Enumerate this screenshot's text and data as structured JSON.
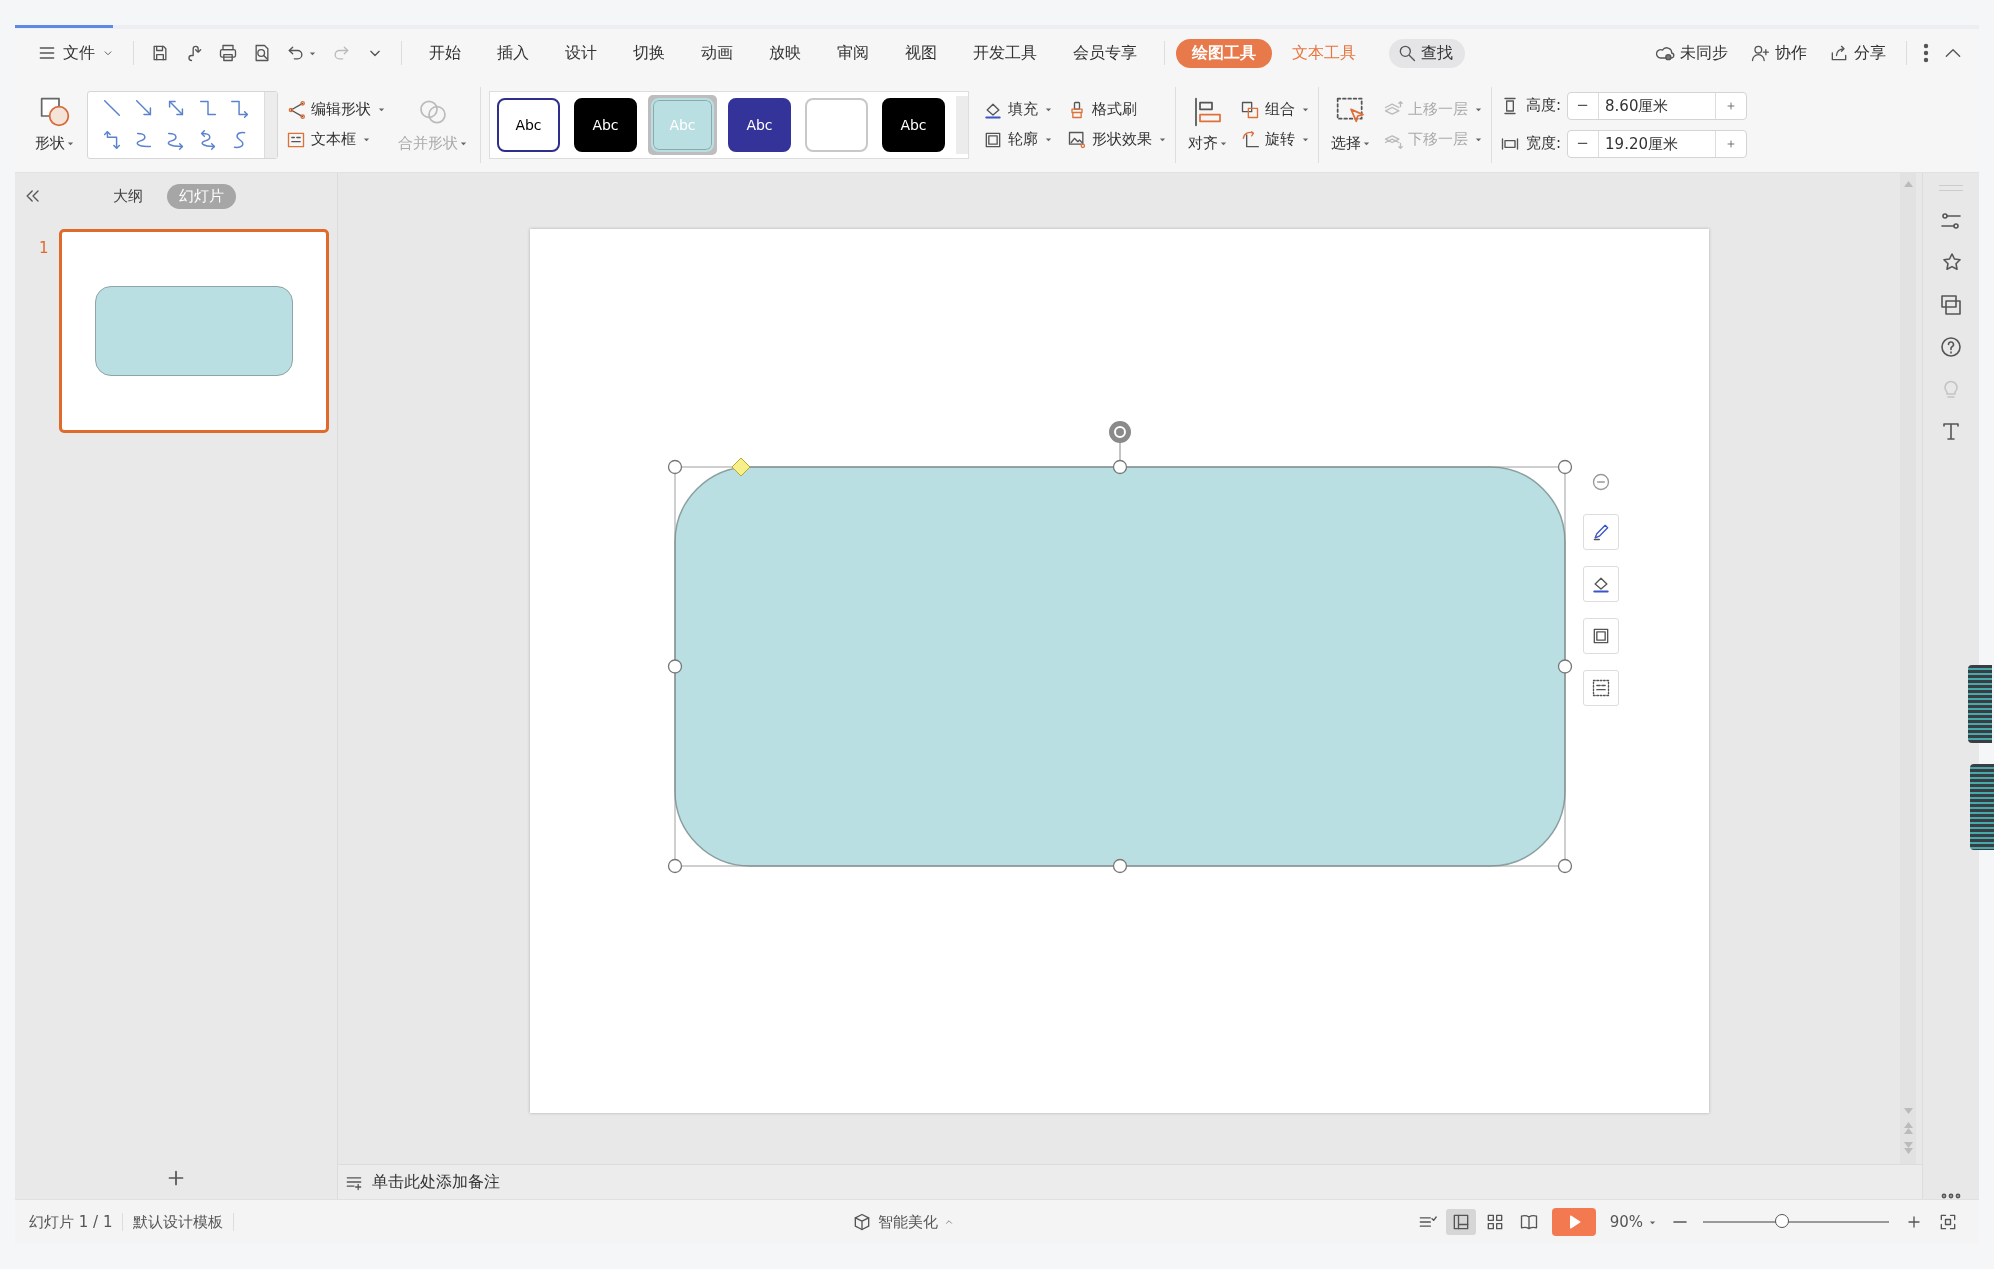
{
  "menu": {
    "file_label": "文件",
    "tabs": [
      {
        "label": "开始",
        "selected": false,
        "kind": "normal"
      },
      {
        "label": "插入",
        "selected": false,
        "kind": "normal"
      },
      {
        "label": "设计",
        "selected": false,
        "kind": "normal"
      },
      {
        "label": "切换",
        "selected": false,
        "kind": "normal"
      },
      {
        "label": "动画",
        "selected": false,
        "kind": "normal"
      },
      {
        "label": "放映",
        "selected": false,
        "kind": "normal"
      },
      {
        "label": "审阅",
        "selected": false,
        "kind": "normal"
      },
      {
        "label": "视图",
        "selected": false,
        "kind": "normal"
      },
      {
        "label": "开发工具",
        "selected": false,
        "kind": "normal"
      },
      {
        "label": "会员专享",
        "selected": false,
        "kind": "normal"
      },
      {
        "label": "绘图工具",
        "selected": true,
        "kind": "context"
      },
      {
        "label": "文本工具",
        "selected": false,
        "kind": "context"
      }
    ],
    "search": "查找",
    "actions": [
      "未同步",
      "协作",
      "分享"
    ]
  },
  "ribbon": {
    "shape_button": {
      "label": "形状",
      "dropdown": true
    },
    "edit_buttons": [
      {
        "label": "编辑形状",
        "dropdown": true,
        "disabled": false
      },
      {
        "label": "文本框",
        "dropdown": true,
        "disabled": false
      }
    ],
    "merge_button": {
      "label": "合并形状",
      "dropdown": true,
      "disabled": true
    },
    "style_swatches": [
      {
        "label": "Abc",
        "color": "#ffffff",
        "selected": false
      },
      {
        "label": "Abc",
        "color": "#000000",
        "selected": false
      },
      {
        "label": "Abc",
        "color": "#badfe2",
        "selected": true
      },
      {
        "label": "Abc",
        "color": "#33339a",
        "selected": false
      },
      {
        "color": "#ffffff",
        "selected": false
      },
      {
        "label": "Abc",
        "color": "#000000",
        "selected": false
      }
    ],
    "format_buttons": [
      {
        "label": "填充",
        "dropdown": true
      },
      {
        "label": "格式刷",
        "dropdown": false
      },
      {
        "label": "轮廓",
        "dropdown": true
      },
      {
        "label": "形状效果",
        "dropdown": true
      }
    ],
    "align_button": {
      "label": "对齐",
      "dropdown": true
    },
    "arrange_buttons": [
      {
        "label": "组合",
        "dropdown": true
      },
      {
        "label": "旋转",
        "dropdown": true
      }
    ],
    "select_button": {
      "label": "选择",
      "dropdown": true
    },
    "layer_buttons": [
      {
        "label": "上移一层",
        "dropdown": true,
        "disabled": true
      },
      {
        "label": "下移一层",
        "dropdown": true,
        "disabled": true
      }
    ],
    "size_fields": [
      {
        "label": "高度:",
        "value": "8.60厘米"
      },
      {
        "label": "宽度:",
        "value": "19.20厘米"
      }
    ]
  },
  "slide_panel": {
    "tabs": [
      {
        "label": "大纲",
        "selected": false
      },
      {
        "label": "幻灯片",
        "selected": true
      }
    ],
    "slides": [
      {
        "number": "1",
        "selected": true
      }
    ]
  },
  "notes": {
    "placeholder": "单击此处添加备注"
  },
  "status_bar": {
    "slide_info": "幻灯片 1 / 1",
    "template": "默认设计模板",
    "beautify": "智能美化",
    "views": [
      {
        "selected": true
      },
      {
        "selected": false
      },
      {
        "selected": false
      }
    ],
    "zoom": "90%",
    "zoom_slider": {
      "level": 0.43
    }
  }
}
